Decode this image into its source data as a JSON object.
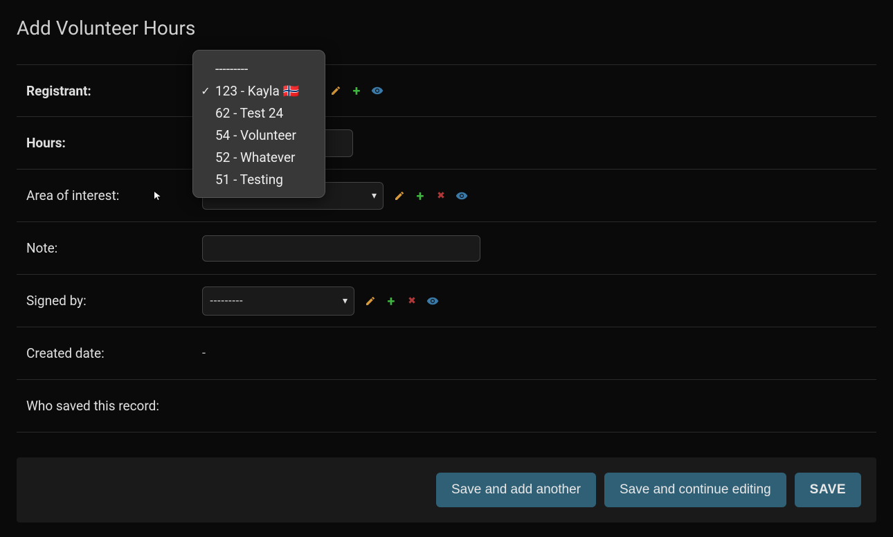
{
  "page_title": "Add Volunteer Hours",
  "labels": {
    "registrant": "Registrant:",
    "hours": "Hours:",
    "aoi": "Area of interest:",
    "note": "Note:",
    "signed_by": "Signed by:",
    "created_date": "Created date:",
    "who_saved": "Who saved this record:"
  },
  "registrant_dropdown": {
    "blank": "---------",
    "options": [
      {
        "label": "123 - Kayla 🇳🇴",
        "selected": true
      },
      {
        "label": "62 - Test 24",
        "selected": false
      },
      {
        "label": "54 - Volunteer",
        "selected": false
      },
      {
        "label": "52 - Whatever",
        "selected": false
      },
      {
        "label": "51 - Testing",
        "selected": false
      }
    ]
  },
  "hours_value": "",
  "aoi_value": "",
  "note_value": "",
  "signed_by_value": "---------",
  "created_date_value": "-",
  "who_saved_value": "",
  "buttons": {
    "save_add": "Save and add another",
    "save_continue": "Save and continue editing",
    "save": "SAVE"
  }
}
